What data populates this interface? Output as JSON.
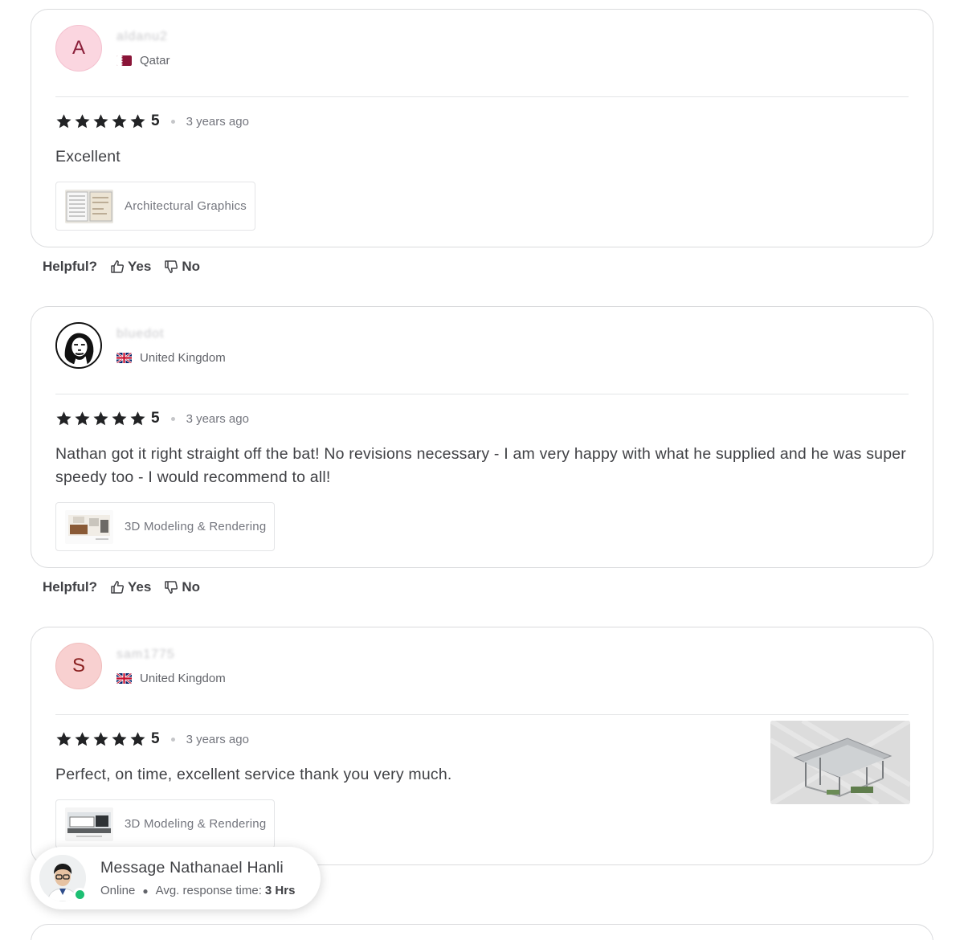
{
  "reviews": [
    {
      "avatar_initial": "A",
      "name": "aldanu2",
      "country": "Qatar",
      "rating": "5",
      "rating_stars": 5,
      "time": "3 years ago",
      "text": "Excellent",
      "gig_label": "Architectural Graphics"
    },
    {
      "avatar_initial": "",
      "name": "bluedot",
      "country": "United Kingdom",
      "rating": "5",
      "rating_stars": 5,
      "time": "3 years ago",
      "text": "Nathan got it right straight off the bat! No revisions necessary - I am very happy with what he supplied and he was super speedy too - I would recommend to all!",
      "gig_label": "3D Modeling & Rendering"
    },
    {
      "avatar_initial": "S",
      "name": "sam1775",
      "country": "United Kingdom",
      "rating": "5",
      "rating_stars": 5,
      "time": "3 years ago",
      "text": "Perfect, on time, excellent service thank you very much.",
      "gig_label": "3D Modeling & Rendering"
    }
  ],
  "helpful": {
    "label": "Helpful?",
    "yes": "Yes",
    "no": "No"
  },
  "message_seller": {
    "title": "Message Nathanael Hanli",
    "status": "Online",
    "response_label": "Avg. response time:",
    "response_value": "3 Hrs"
  },
  "colors": {
    "star": "#222325",
    "online": "#1dbf73",
    "qatar_flag": "#8a1538"
  },
  "icons": [
    "star-icon",
    "thumbs-up-icon",
    "thumbs-down-icon",
    "qatar-flag-icon",
    "uk-flag-icon"
  ]
}
